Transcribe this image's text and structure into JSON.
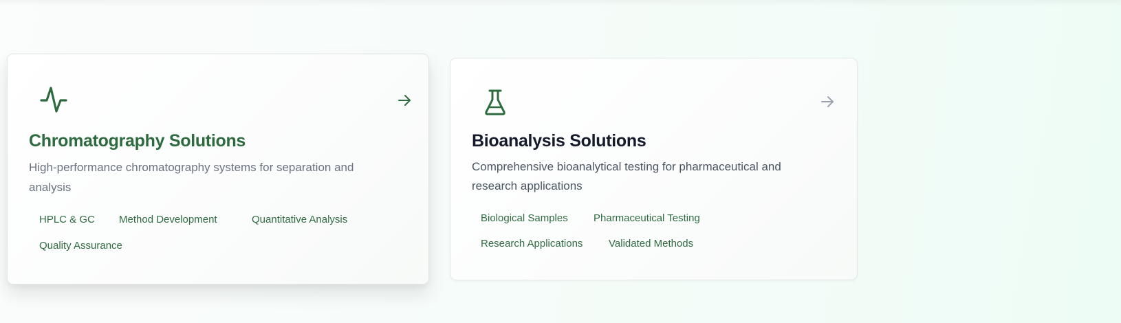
{
  "colors": {
    "brand_green": "#2d6a3e",
    "heading_dark": "#151a2d",
    "muted_text": "#6b7280",
    "arrow_inactive": "#9ca3af"
  },
  "cards": [
    {
      "title": "Chromatography Solutions",
      "description": "High-performance chromatography systems for separation and analysis",
      "icon": "activity-icon",
      "arrow_icon": "arrow-right-icon",
      "state": "hovered",
      "tags": [
        "HPLC & GC",
        "Method Development",
        "Quantitative Analysis",
        "Quality Assurance"
      ]
    },
    {
      "title": "Bioanalysis Solutions",
      "description": "Comprehensive bioanalytical testing for pharmaceutical and research applications",
      "icon": "flask-icon",
      "arrow_icon": "arrow-right-icon",
      "state": "default",
      "tags": [
        "Biological Samples",
        "Pharmaceutical Testing",
        "Research Applications",
        "Validated Methods"
      ]
    }
  ]
}
